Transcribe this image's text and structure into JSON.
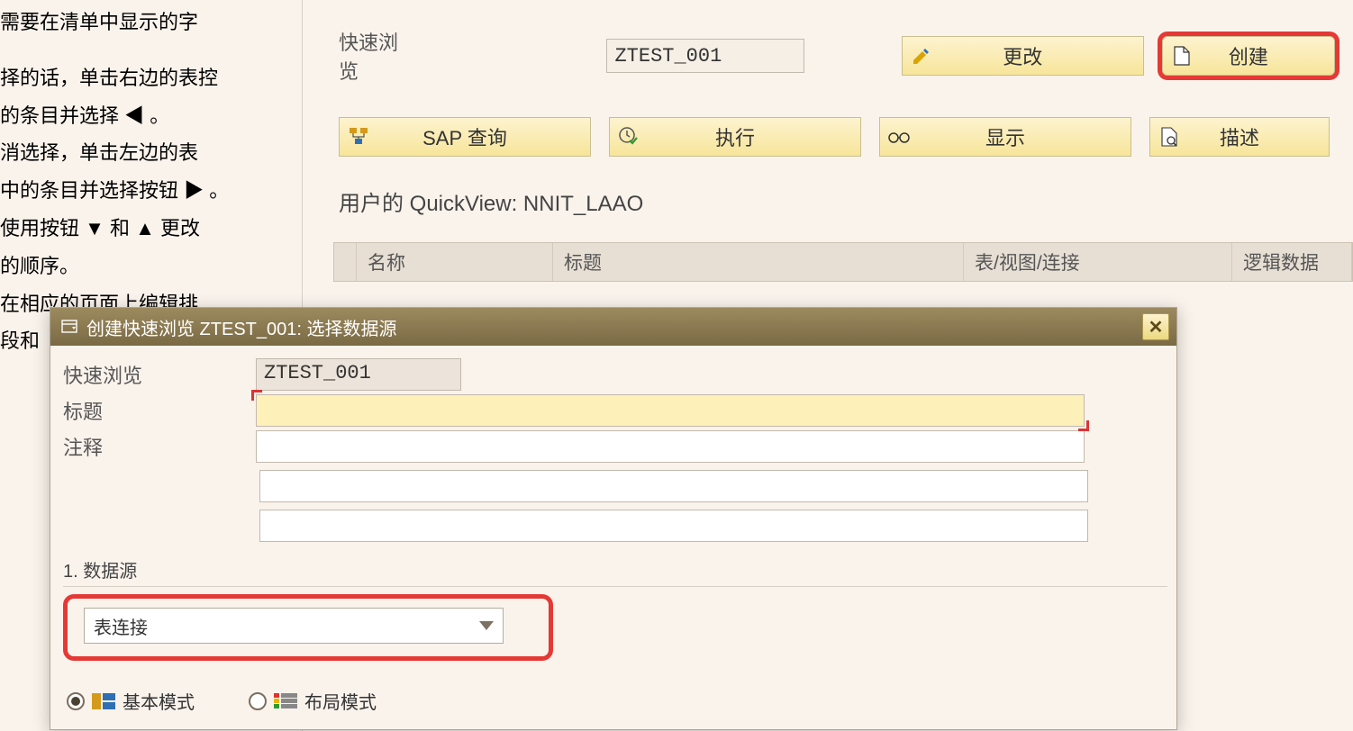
{
  "help": {
    "line1": "需要在清单中显示的字",
    "line2": "择的话，单击右边的表控",
    "line3": "的条目并选择 ◀ 。",
    "line4": "消选择，单击左边的表",
    "line5": "中的条目并选择按钮 ▶ 。",
    "line6": "使用按钮 ▼ 和 ▲ 更改",
    "line7": "的顺序。",
    "line8": "在相应的页面上编辑排",
    "line9": "段和"
  },
  "header": {
    "quickview_label": "快速浏览",
    "quickview_value": "ZTEST_001",
    "btn_change": "更改",
    "btn_create": "创建",
    "btn_sapquery": "SAP 查询",
    "btn_execute": "执行",
    "btn_display": "显示",
    "btn_describe": "描述",
    "user_heading": "用户的 QuickView: NNIT_LAAO"
  },
  "table": {
    "col_name": "名称",
    "col_title": "标题",
    "col_table": "表/视图/连接",
    "col_logic": "逻辑数据"
  },
  "dialog": {
    "title": "创建快速浏览 ZTEST_001: 选择数据源",
    "quickview_label": "快速浏览",
    "quickview_value": "ZTEST_001",
    "title_label": "标题",
    "title_value": "",
    "comment_label": "注释",
    "comment_value": "",
    "section1": "1. 数据源",
    "datasource_selected": "表连接",
    "mode_basic": "基本模式",
    "mode_layout": "布局模式"
  }
}
